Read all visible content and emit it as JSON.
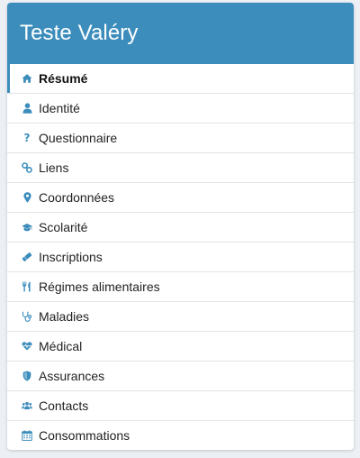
{
  "header": {
    "title": "Teste Valéry"
  },
  "colors": {
    "accent": "#3c8dbc",
    "icon": "#3c8dbc",
    "divider": "#e4e4e4"
  },
  "menu": {
    "items": [
      {
        "label": "Résumé",
        "icon": "home-icon",
        "active": true
      },
      {
        "label": "Identité",
        "icon": "user-icon"
      },
      {
        "label": "Questionnaire",
        "icon": "question-icon"
      },
      {
        "label": "Liens",
        "icon": "link-icon"
      },
      {
        "label": "Coordonnées",
        "icon": "map-marker-icon"
      },
      {
        "label": "Scolarité",
        "icon": "graduation-cap-icon"
      },
      {
        "label": "Inscriptions",
        "icon": "ticket-icon"
      },
      {
        "label": "Régimes alimentaires",
        "icon": "utensils-icon"
      },
      {
        "label": "Maladies",
        "icon": "stethoscope-icon"
      },
      {
        "label": "Médical",
        "icon": "heartbeat-icon"
      },
      {
        "label": "Assurances",
        "icon": "shield-icon"
      },
      {
        "label": "Contacts",
        "icon": "users-icon"
      },
      {
        "label": "Consommations",
        "icon": "calendar-icon"
      }
    ]
  }
}
